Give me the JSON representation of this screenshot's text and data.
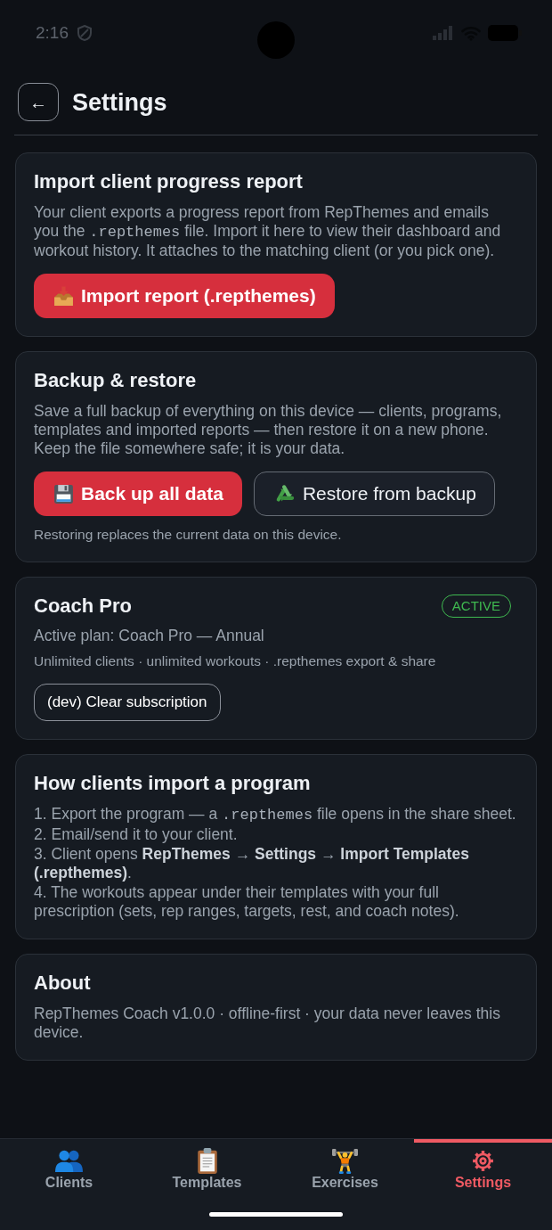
{
  "status_bar": {
    "time": "2:16"
  },
  "header": {
    "back_label": "←",
    "title": "Settings"
  },
  "sections": [
    {
      "title": "Import client progress report",
      "body": [
        {
          "kind": "text",
          "text": "Your client exports a progress report from RepThemes and emails you the "
        },
        {
          "kind": "code",
          "text": ".repthemes"
        },
        {
          "kind": "text",
          "text": " file. Import it here to view their dashboard and workout history. It attaches to the matching client (or you pick one)."
        }
      ],
      "buttons": [
        {
          "kind": "import",
          "label": "Import report (.repthemes)"
        }
      ]
    },
    {
      "title": "Backup & restore",
      "body": [
        {
          "kind": "text",
          "text": "Save a full backup of everything on this device — clients, programs, templates and imported reports — then restore it on a new phone. Keep the file somewhere safe; it is your data."
        }
      ],
      "buttons": [
        {
          "kind": "backup",
          "label": "Back up all data"
        },
        {
          "kind": "restore",
          "label": "Restore from backup"
        }
      ],
      "note": "Restoring replaces the current data on this device."
    },
    {
      "title": "Coach Pro",
      "badge": "ACTIVE",
      "plan": "Active plan: Coach Pro — Annual",
      "features": "Unlimited clients · unlimited workouts · .repthemes export & share",
      "buttons": [
        {
          "kind": "dev",
          "label": "(dev) Clear subscription"
        }
      ]
    },
    {
      "title": "How clients import a program",
      "steps": [
        [
          {
            "kind": "text",
            "text": "1. Export the program — a "
          },
          {
            "kind": "code",
            "text": ".repthemes"
          },
          {
            "kind": "text",
            "text": " file opens in the share sheet."
          }
        ],
        [
          {
            "kind": "text",
            "text": "2. Email/send it to your client."
          }
        ],
        [
          {
            "kind": "text",
            "text": "3. Client opens **RepThemes** → **Settings** → **Import Templates (.repthemes)**."
          }
        ],
        [
          {
            "kind": "text",
            "text": "4. The workouts appear under their templates with your full prescription (sets, rep ranges, targets, rest, and coach notes)."
          }
        ]
      ]
    },
    {
      "title": "About",
      "body": [
        {
          "kind": "text",
          "text": "RepThemes Coach v1.0.0 · offline-first · your data never leaves this device."
        }
      ]
    }
  ],
  "tabs": [
    {
      "label": "Clients",
      "selected": false
    },
    {
      "label": "Templates",
      "selected": false
    },
    {
      "label": "Exercises",
      "selected": false
    },
    {
      "label": "Settings",
      "selected": true
    }
  ]
}
